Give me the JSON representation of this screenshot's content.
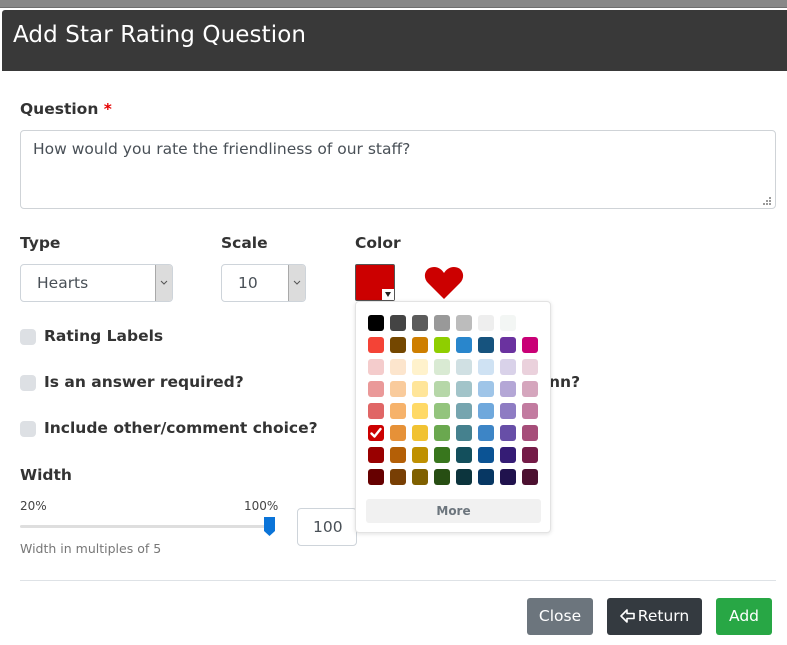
{
  "dialog": {
    "title": "Add Star Rating Question"
  },
  "question": {
    "label": "Question",
    "required_marker": "*",
    "value": "How would you rate the friendliness of our staff?"
  },
  "type": {
    "label": "Type",
    "selected": "Hearts"
  },
  "scale": {
    "label": "Scale",
    "selected": "10"
  },
  "color": {
    "label": "Color",
    "selected_hex": "#cc0000",
    "preview_icon": "heart-icon",
    "palette": [
      [
        "#000000",
        "#444444",
        "#5b5b5b",
        "#999999",
        "#bcbcbc",
        "#eeeeee",
        "#f3f6f4",
        "#ffffff"
      ],
      [
        "#f44336",
        "#744700",
        "#ce7e00",
        "#8fce00",
        "#2986cc",
        "#16537e",
        "#6a329f",
        "#c90076"
      ],
      [
        "#f4cccc",
        "#fce5cd",
        "#fff2cc",
        "#d9ead3",
        "#d0e0e3",
        "#cfe2f3",
        "#d9d2e9",
        "#ead1dc"
      ],
      [
        "#ea9999",
        "#f9cb9c",
        "#ffe599",
        "#b6d7a8",
        "#a2c4c9",
        "#9fc5e8",
        "#b4a7d6",
        "#d5a6bd"
      ],
      [
        "#e06666",
        "#f6b26b",
        "#ffd966",
        "#93c47d",
        "#76a5af",
        "#6fa8dc",
        "#8e7cc3",
        "#c27ba0"
      ],
      [
        "#cc0000",
        "#e69138",
        "#f1c232",
        "#6aa84f",
        "#45818e",
        "#3d85c6",
        "#674ea7",
        "#a64d79"
      ],
      [
        "#990000",
        "#b45f06",
        "#bf9000",
        "#38761d",
        "#134f5c",
        "#0b5394",
        "#351c75",
        "#741b47"
      ],
      [
        "#660000",
        "#783f04",
        "#7f6000",
        "#274e13",
        "#0c343d",
        "#073763",
        "#20124d",
        "#4c1130"
      ]
    ],
    "more_label": "More"
  },
  "options": [
    {
      "label": "Rating Labels",
      "checked": false
    },
    {
      "label": "Is an answer required?",
      "checked": false
    },
    {
      "label": "Include other/comment choice?",
      "checked": false
    }
  ],
  "partial_hidden_text": "nn?",
  "width": {
    "label": "Width",
    "min_label": "20%",
    "max_label": "100%",
    "value_percent": 100,
    "input_value": "100",
    "help": "Width in multiples of 5"
  },
  "footer": {
    "close_label": "Close",
    "return_label": "Return",
    "add_label": "Add"
  }
}
